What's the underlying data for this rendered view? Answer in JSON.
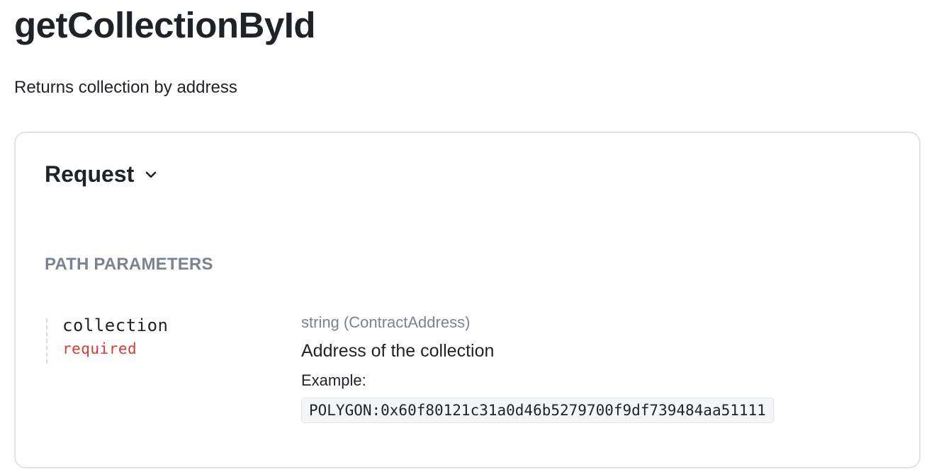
{
  "operation": {
    "title": "getCollectionById",
    "description": "Returns collection by address"
  },
  "request": {
    "title": "Request",
    "chevron_icon": "chevron-down-icon",
    "section_label": "PATH PARAMETERS",
    "params": [
      {
        "name": "collection",
        "required_label": "required",
        "type": "string (ContractAddress)",
        "description": "Address of the collection",
        "example_label": "Example:",
        "example_value": "POLYGON:0x60f80121c31a0d46b5279700f9df739484aa51111"
      }
    ]
  },
  "colors": {
    "text": "#1f2328",
    "muted": "#7a8391",
    "required": "#d93b30",
    "border": "#e1e4e8",
    "code_bg": "#f4f5f7"
  }
}
